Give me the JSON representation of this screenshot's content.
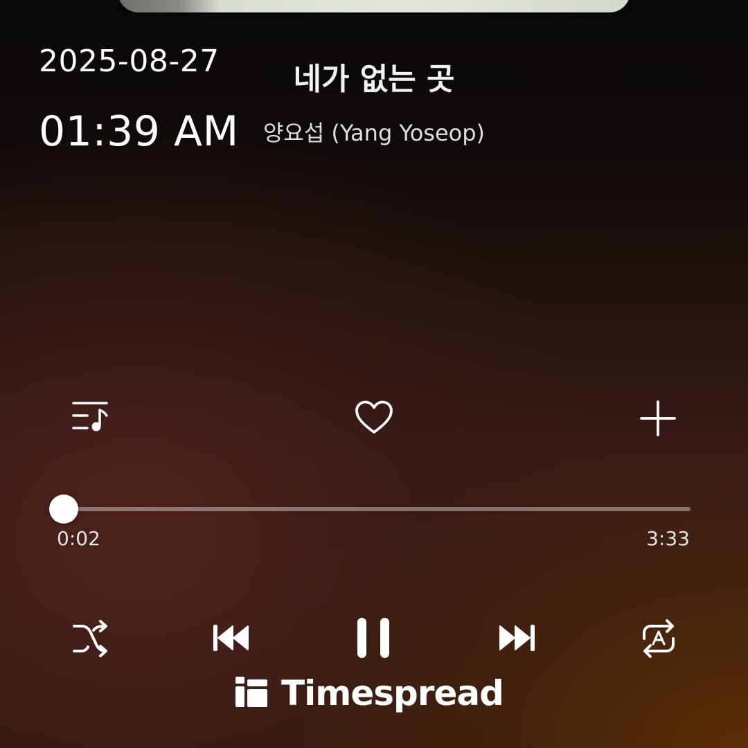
{
  "status": {
    "date": "2025-08-27",
    "time": "01:39 AM"
  },
  "track": {
    "title": "네가 없는 곳",
    "artist": "양요섭 (Yang Yoseop)"
  },
  "actions": {
    "lyrics_icon": "lyrics-queue-icon",
    "like_icon": "heart-icon",
    "add_icon": "plus-icon"
  },
  "playback": {
    "elapsed": "0:02",
    "duration": "3:33",
    "progress_fraction": 0.0
  },
  "controls": {
    "shuffle_icon": "shuffle-icon",
    "previous_icon": "skip-previous-icon",
    "play_state": "pause",
    "next_icon": "skip-next-icon",
    "repeat_icon": "repeat-auto-icon"
  },
  "watermark": {
    "text": "Timespread"
  },
  "colors": {
    "text": "#ffffff",
    "track_background": "#ffffff61",
    "accent_brown": "#5c3006",
    "accent_maroon": "#4e221e"
  }
}
